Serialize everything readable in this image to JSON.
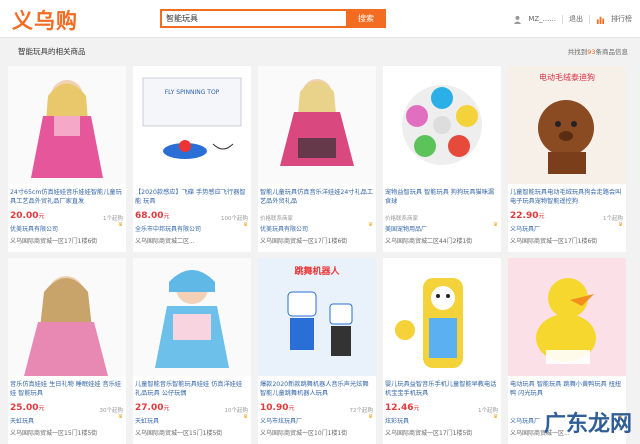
{
  "logo": "义乌购",
  "search": {
    "value": "智能玩具",
    "button": "搜索"
  },
  "user": {
    "name": "MZ_......",
    "logout": "退出",
    "rank": "排行榜"
  },
  "result": {
    "title": "智能玩具的相关商品",
    "count_prefix": "共找到",
    "count": "93",
    "count_suffix": "条商品信息"
  },
  "products": [
    {
      "title": "24寸65cm仿真娃娃音乐娃娃智能儿童玩具工艺品外贸礼品厂家直发",
      "price": "20.00",
      "unit": "元",
      "moq": "1个起购",
      "shop": "优美玩具有限公司",
      "addr": "义乌国际商贸城一区17门1楼6街"
    },
    {
      "title": "【2020款感应】飞碟 手势感应飞行器智能 玩具",
      "price": "68.00",
      "unit": "元",
      "moq": "100个起购",
      "shop": "全乐市中邦玩具有限公司",
      "addr": "义乌国际商贸城二区..."
    },
    {
      "title": "智能儿童玩具仿真音乐洋娃娃24寸礼品工艺品外贸礼品",
      "price": "",
      "unit": "",
      "moq": "价格联系商家",
      "shop": "优美玩具有限公司",
      "addr": "义乌国际商贸城一区17门1楼6街"
    },
    {
      "title": "宠物益智玩具 智能玩具 狗狗玩具猫咪漏食球",
      "price": "",
      "unit": "",
      "moq": "价格联系商家",
      "shop": "美国宠物用品厂",
      "addr": "义乌国际商贸城二区44门2楼1街"
    },
    {
      "title": "儿童智能玩具电动毛绒玩具狗会走路会叫电子玩具宠物智能遥控狗",
      "price": "22.90",
      "unit": "元",
      "moq": "1个起购",
      "shop": "义乌玩具厂",
      "addr": "义乌国际商贸城一区17门1楼6街"
    },
    {
      "title": "音乐仿真娃娃 生日礼物 睡眠娃娃 音乐娃娃 智能玩具",
      "price": "25.00",
      "unit": "元",
      "moq": "30个起购",
      "shop": "天虹玩具",
      "addr": "义乌国际商贸城一区15门1楼5街"
    },
    {
      "title": "儿童智能音乐智能玩具娃娃 仿真洋娃娃 礼品玩具 公仔玩偶",
      "price": "27.00",
      "unit": "元",
      "moq": "10个起购",
      "shop": "天虹玩具",
      "addr": "义乌国际商贸城一区15门1楼5街"
    },
    {
      "title": "爆款2020新款跳舞机器人音乐声光炫舞智能儿童跳舞机器人玩具",
      "price": "10.90",
      "unit": "元",
      "moq": "72个起购",
      "shop": "义乌市炫玩具厂",
      "addr": "义乌国际商贸城一区10门1楼1街"
    },
    {
      "title": "婴儿玩具益智音乐手机儿童智能早教电话机宝宝手机玩具",
      "price": "12.46",
      "unit": "元",
      "moq": "1个起购",
      "shop": "炫彩玩具",
      "addr": "义乌国际商贸城一区17门1楼5街"
    },
    {
      "title": "电动玩具 智能玩具 跳舞小黄鸭玩具 扭扭鸭 闪光玩具",
      "price": "",
      "unit": "",
      "moq": "",
      "shop": "义乌玩具厂",
      "addr": "义乌国际商贸城一区..."
    }
  ],
  "watermark": "广东龙网",
  "colors": {
    "brand": "#f26c21",
    "price": "#e4393c",
    "link": "#3366aa"
  }
}
